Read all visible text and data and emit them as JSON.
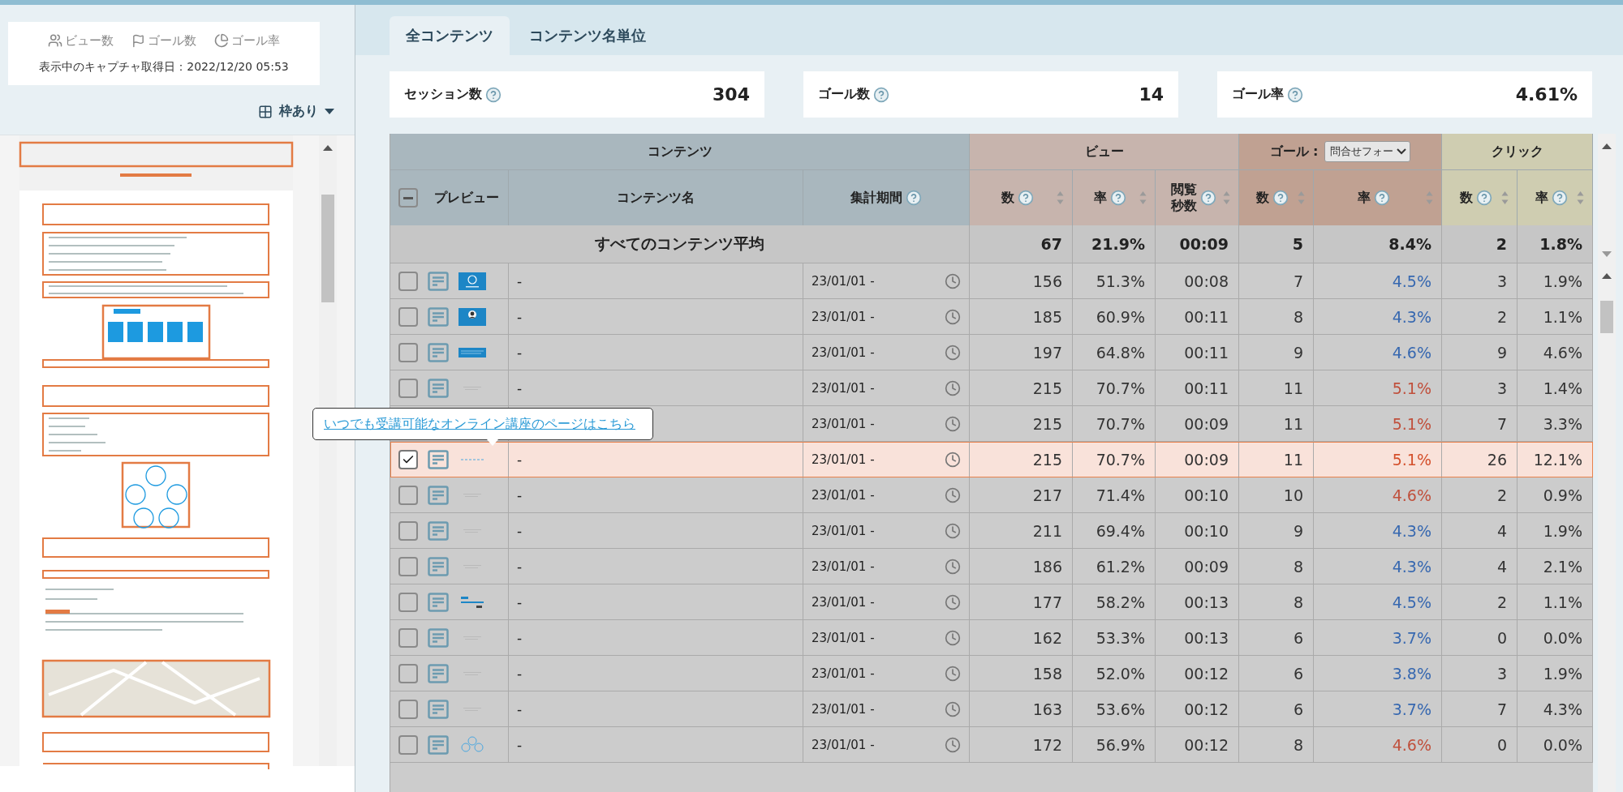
{
  "legend": [
    {
      "kind": "views",
      "label": "ビュー数"
    },
    {
      "kind": "goals",
      "label": "ゴール数"
    },
    {
      "kind": "rate",
      "label": "ゴール率"
    }
  ],
  "capture_date": "表示中のキャプチャ取得日：2022/12/20 05:53",
  "frame_toggle": {
    "label": "枠あり"
  },
  "tooltip": {
    "link": "いつでも受講可能なオンライン講座のページはこちら"
  },
  "tabs": [
    {
      "label": "全コンテンツ",
      "selected": true
    },
    {
      "label": "コンテンツ名単位",
      "selected": false
    }
  ],
  "summary": [
    {
      "label": "セッション数",
      "value": "304"
    },
    {
      "label": "ゴール数",
      "value": "14"
    },
    {
      "label": "ゴール率",
      "value": "4.61%"
    }
  ],
  "table": {
    "select_all": {
      "indeterminate": true
    },
    "groups": [
      {
        "kind": "content",
        "label": "コンテンツ",
        "columns": [
          {
            "label": "プレビュー",
            "help": false,
            "sortable": false
          },
          {
            "label": "コンテンツ名",
            "help": false,
            "sortable": false
          },
          {
            "label": "集計期間",
            "help": true,
            "sortable": false
          }
        ]
      },
      {
        "kind": "view",
        "label": "ビュー",
        "columns": [
          {
            "label": "数",
            "help": true,
            "sortable": true
          },
          {
            "label": "率",
            "help": true,
            "sortable": true
          },
          {
            "label": "閲覧秒数",
            "help": true,
            "sortable": true
          }
        ]
      },
      {
        "kind": "goal",
        "label": "ゴール :",
        "select": "問合せフォー",
        "columns": [
          {
            "label": "数",
            "help": true,
            "sortable": true
          },
          {
            "label": "率",
            "help": true,
            "sortable": true
          }
        ]
      },
      {
        "kind": "click",
        "label": "クリック",
        "columns": [
          {
            "label": "数",
            "help": true,
            "sortable": true
          },
          {
            "label": "率",
            "help": true,
            "sortable": true
          }
        ]
      }
    ],
    "average": {
      "label": "すべてのコンテンツ平均",
      "values": [
        "67",
        "21.9%",
        "00:09",
        "5",
        "8.4%",
        "2",
        "1.8%"
      ]
    },
    "rows": [
      {
        "checked": false,
        "name": "-",
        "period": "23/01/01 -",
        "values": [
          "156",
          "51.3%",
          "00:08",
          "7"
        ],
        "goal_rate": {
          "text": "4.5%",
          "color": "#3768b0"
        },
        "clicks": [
          "3",
          "1.9%"
        ]
      },
      {
        "checked": false,
        "name": "-",
        "period": "23/01/01 -",
        "values": [
          "185",
          "60.9%",
          "00:11",
          "8"
        ],
        "goal_rate": {
          "text": "4.3%",
          "color": "#3768b0"
        },
        "clicks": [
          "2",
          "1.1%"
        ]
      },
      {
        "checked": false,
        "name": "-",
        "period": "23/01/01 -",
        "values": [
          "197",
          "64.8%",
          "00:11",
          "9"
        ],
        "goal_rate": {
          "text": "4.6%",
          "color": "#3768b0"
        },
        "clicks": [
          "9",
          "4.6%"
        ]
      },
      {
        "checked": false,
        "name": "-",
        "period": "23/01/01 -",
        "values": [
          "215",
          "70.7%",
          "00:11",
          "11"
        ],
        "goal_rate": {
          "text": "5.1%",
          "color": "#c0503c"
        },
        "clicks": [
          "3",
          "1.4%"
        ]
      },
      {
        "period": "23/01/01 -",
        "values": [
          "215",
          "70.7%",
          "00:09",
          "11"
        ],
        "goal_rate": {
          "text": "5.1%",
          "color": "#c0503c"
        },
        "clicks": [
          "7",
          "3.3%"
        ]
      },
      {
        "checked": true,
        "name": "-",
        "period": "23/01/01 -",
        "values": [
          "215",
          "70.7%",
          "00:09",
          "11"
        ],
        "goal_rate": {
          "text": "5.1%",
          "color": "#d4502c"
        },
        "clicks": [
          "26",
          "12.1%"
        ]
      },
      {
        "checked": false,
        "name": "-",
        "period": "23/01/01 -",
        "values": [
          "217",
          "71.4%",
          "00:10",
          "10"
        ],
        "goal_rate": {
          "text": "4.6%",
          "color": "#c0503c"
        },
        "clicks": [
          "2",
          "0.9%"
        ]
      },
      {
        "checked": false,
        "name": "-",
        "period": "23/01/01 -",
        "values": [
          "211",
          "69.4%",
          "00:10",
          "9"
        ],
        "goal_rate": {
          "text": "4.3%",
          "color": "#3768b0"
        },
        "clicks": [
          "4",
          "1.9%"
        ]
      },
      {
        "checked": false,
        "name": "-",
        "period": "23/01/01 -",
        "values": [
          "186",
          "61.2%",
          "00:09",
          "8"
        ],
        "goal_rate": {
          "text": "4.3%",
          "color": "#3768b0"
        },
        "clicks": [
          "4",
          "2.1%"
        ]
      },
      {
        "checked": false,
        "name": "-",
        "period": "23/01/01 -",
        "values": [
          "177",
          "58.2%",
          "00:13",
          "8"
        ],
        "goal_rate": {
          "text": "4.5%",
          "color": "#3768b0"
        },
        "clicks": [
          "2",
          "1.1%"
        ]
      },
      {
        "checked": false,
        "name": "-",
        "period": "23/01/01 -",
        "values": [
          "162",
          "53.3%",
          "00:13",
          "6"
        ],
        "goal_rate": {
          "text": "3.7%",
          "color": "#3768b0"
        },
        "clicks": [
          "0",
          "0.0%"
        ]
      },
      {
        "checked": false,
        "name": "-",
        "period": "23/01/01 -",
        "values": [
          "158",
          "52.0%",
          "00:12",
          "6"
        ],
        "goal_rate": {
          "text": "3.8%",
          "color": "#3768b0"
        },
        "clicks": [
          "3",
          "1.9%"
        ]
      },
      {
        "checked": false,
        "name": "-",
        "period": "23/01/01 -",
        "values": [
          "163",
          "53.6%",
          "00:12",
          "6"
        ],
        "goal_rate": {
          "text": "3.7%",
          "color": "#3768b0"
        },
        "clicks": [
          "7",
          "4.3%"
        ]
      },
      {
        "checked": false,
        "name": "-",
        "period": "23/01/01 -",
        "values": [
          "172",
          "56.9%",
          "00:12",
          "8"
        ],
        "goal_rate": {
          "text": "4.6%",
          "color": "#c0503c"
        },
        "clicks": [
          "0",
          "0.0%"
        ]
      }
    ]
  }
}
